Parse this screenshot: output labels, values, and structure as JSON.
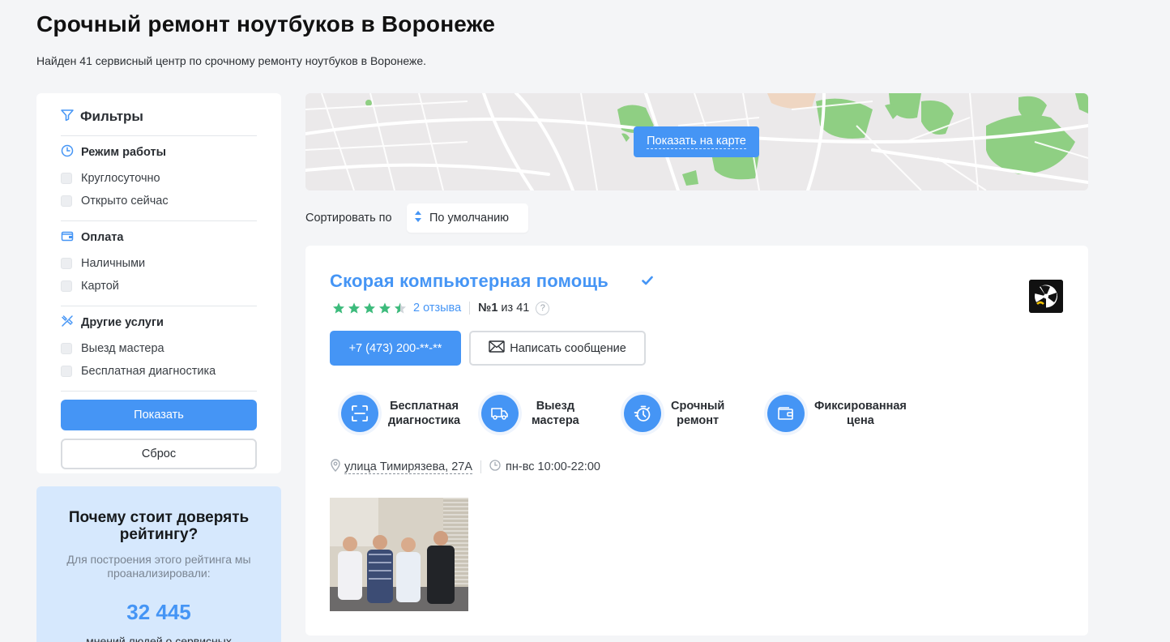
{
  "page": {
    "title": "Срочный ремонт ноутбуков в Воронеже",
    "subtitle": "Найден 41 сервисный центр по срочному ремонту ноутбуков в Воронеже."
  },
  "filters": {
    "title": "Фильтры",
    "groups": [
      {
        "title": "Режим работы",
        "icon": "clock-icon",
        "options": [
          "Круглосуточно",
          "Открыто сейчас"
        ]
      },
      {
        "title": "Оплата",
        "icon": "wallet-icon",
        "options": [
          "Наличными",
          "Картой"
        ]
      },
      {
        "title": "Другие услуги",
        "icon": "tools-icon",
        "options": [
          "Выезд мастера",
          "Бесплатная диагностика"
        ]
      }
    ],
    "show_label": "Показать",
    "reset_label": "Сброс"
  },
  "trust": {
    "title": "Почему стоит доверять рейтингу?",
    "text": "Для построения этого рейтинга мы проанализировали:",
    "number": "32 445",
    "footer": "мнений людей о сервисных"
  },
  "map": {
    "button_label": "Показать на карте"
  },
  "sort": {
    "label": "Сортировать по",
    "selected": "По умолчанию"
  },
  "card": {
    "name": "Скорая компьютерная помощь",
    "rating_value": 4.5,
    "rating_max": 5,
    "reviews": "2 отзыва",
    "rank_prefix": "№1",
    "rank_suffix": "из 41",
    "help": "?",
    "phone_label": "+7 (473) 200-**-**",
    "message_label": "Написать сообщение",
    "features": [
      {
        "label_line1": "Бесплатная",
        "label_line2": "диагностика",
        "icon": "scan-icon"
      },
      {
        "label_line1": "Выезд",
        "label_line2": "мастера",
        "icon": "truck-icon"
      },
      {
        "label_line1": "Срочный",
        "label_line2": "ремонт",
        "icon": "stopwatch-icon"
      },
      {
        "label_line1": "Фиксированная",
        "label_line2": "цена",
        "icon": "wallet-icon"
      }
    ],
    "address": "улица Тимирязева, 27А",
    "hours": "пн-вс 10:00-22:00"
  },
  "colors": {
    "accent": "#4595f5",
    "star": "#3dbb7c",
    "panel": "#ffffff",
    "background": "#f4f5f7",
    "trust_bg": "#d6e8fd"
  }
}
